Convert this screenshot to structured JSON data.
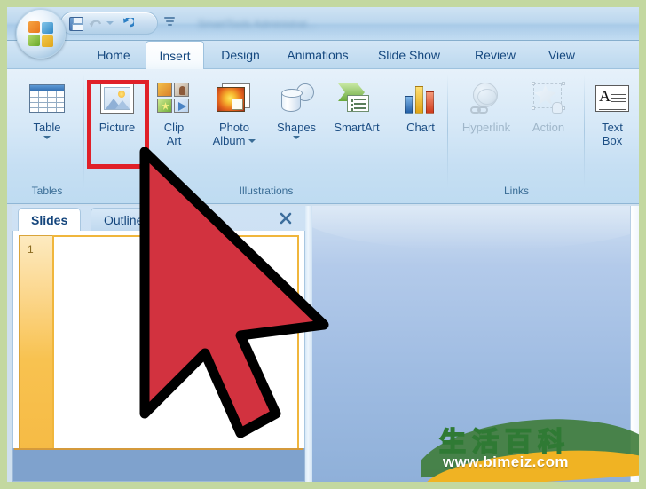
{
  "app": {
    "title_bar_blurred_text": "SmartTools Administrat...",
    "office_orb": "office-orb"
  },
  "quick_access": {
    "save_label": "Save",
    "undo_label": "Undo",
    "undo_more_label": "Undo options",
    "redo_label": "Redo",
    "customize_label": "Customize Quick Access Toolbar"
  },
  "ribbon": {
    "tabs": [
      {
        "label": "Home",
        "active": false
      },
      {
        "label": "Insert",
        "active": true
      },
      {
        "label": "Design",
        "active": false
      },
      {
        "label": "Animations",
        "active": false
      },
      {
        "label": "Slide Show",
        "active": false
      },
      {
        "label": "Review",
        "active": false
      },
      {
        "label": "View",
        "active": false
      }
    ],
    "groups": [
      {
        "label": "Tables",
        "buttons": [
          {
            "label": "Table",
            "icon": "table-icon",
            "has_caret": true,
            "disabled": false
          }
        ]
      },
      {
        "label": "Illustrations",
        "buttons": [
          {
            "label": "Picture",
            "icon": "picture-icon",
            "has_caret": false,
            "disabled": false,
            "highlighted": true
          },
          {
            "label": "Clip\nArt",
            "icon": "clip-art-icon",
            "has_caret": false,
            "disabled": false
          },
          {
            "label": "Photo\nAlbum",
            "icon": "photo-album-icon",
            "has_caret": true,
            "disabled": false
          },
          {
            "label": "Shapes",
            "icon": "shapes-icon",
            "has_caret": true,
            "disabled": false
          },
          {
            "label": "SmartArt",
            "icon": "smartart-icon",
            "has_caret": false,
            "disabled": false
          },
          {
            "label": "Chart",
            "icon": "chart-icon",
            "has_caret": false,
            "disabled": false
          }
        ]
      },
      {
        "label": "Links",
        "buttons": [
          {
            "label": "Hyperlink",
            "icon": "hyperlink-icon",
            "has_caret": false,
            "disabled": true
          },
          {
            "label": "Action",
            "icon": "action-icon",
            "has_caret": false,
            "disabled": true
          }
        ]
      },
      {
        "label": "",
        "buttons": [
          {
            "label": "Text\nBox",
            "icon": "text-box-icon",
            "has_caret": false,
            "disabled": false
          }
        ]
      }
    ],
    "button_labels": {
      "table": "Table",
      "picture": "Picture",
      "clip_art_line1": "Clip",
      "clip_art_line2": "Art",
      "photo_album_line1": "Photo",
      "photo_album_line2": "Album",
      "shapes": "Shapes",
      "smartart": "SmartArt",
      "chart": "Chart",
      "hyperlink": "Hyperlink",
      "action": "Action",
      "text_box_line1": "Text",
      "text_box_line2": "Box"
    },
    "group_labels": {
      "tables": "Tables",
      "illustrations": "Illustrations",
      "links": "Links",
      "text": ""
    }
  },
  "left_panel": {
    "tabs": [
      {
        "label": "Slides",
        "active": true
      },
      {
        "label": "Outline",
        "active": false
      }
    ],
    "close_label": "Close",
    "slide_number": "1"
  },
  "annotations": {
    "highlight_target": "picture-button",
    "highlight_color": "#e02028",
    "cursor_color": "#d2323f",
    "cursor_outline": "#000000"
  },
  "watermark": {
    "chinese_text": "生活百科",
    "url": "www.bimeiz.com",
    "green": "#3f7c3a",
    "yellow": "#f0b323"
  }
}
